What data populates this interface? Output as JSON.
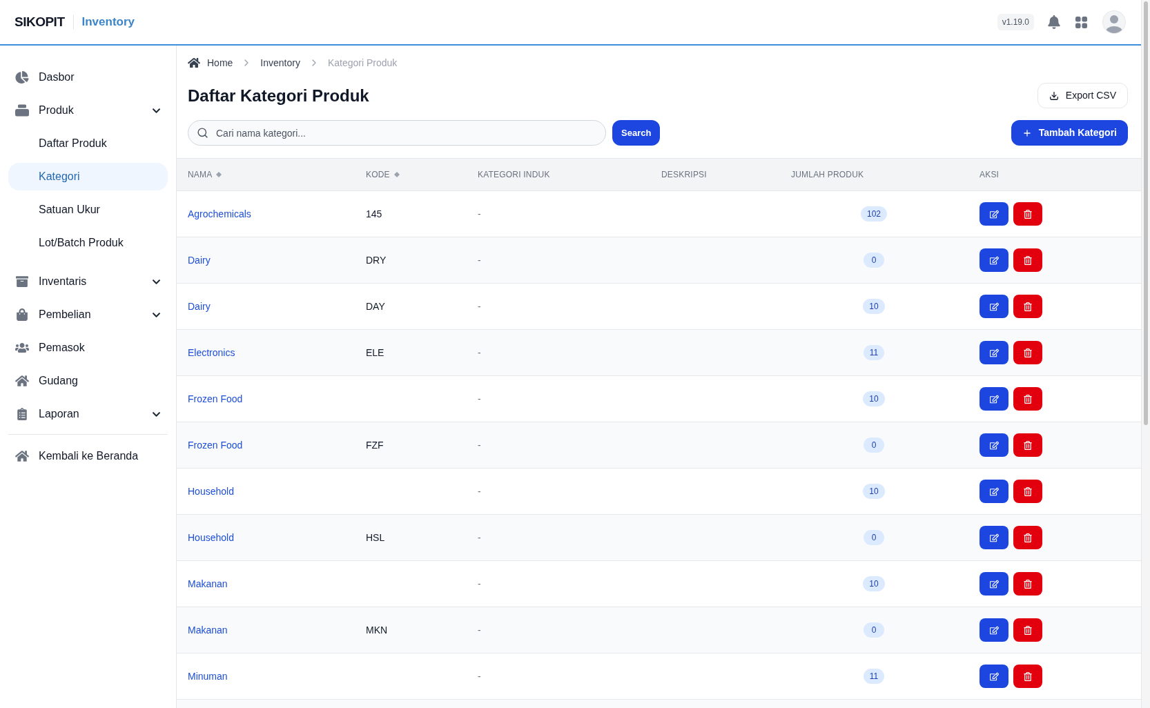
{
  "header": {
    "brand": "SIKOPIT",
    "module": "Inventory",
    "version": "v1.19.0"
  },
  "sidebar": {
    "items": [
      {
        "label": "Dasbor",
        "kind": "link",
        "selected": false
      },
      {
        "label": "Produk",
        "kind": "group",
        "selected": false,
        "children": [
          {
            "label": "Daftar Produk",
            "selected": false
          },
          {
            "label": "Kategori",
            "selected": true
          },
          {
            "label": "Satuan Ukur",
            "selected": false
          },
          {
            "label": "Lot/Batch Produk",
            "selected": false
          }
        ]
      },
      {
        "label": "Inventaris",
        "kind": "group",
        "selected": false
      },
      {
        "label": "Pembelian",
        "kind": "group",
        "selected": false
      },
      {
        "label": "Pemasok",
        "kind": "link",
        "selected": false
      },
      {
        "label": "Gudang",
        "kind": "link",
        "selected": false
      },
      {
        "label": "Laporan",
        "kind": "group",
        "selected": false
      }
    ],
    "footer_items": [
      {
        "label": "Kembali ke Beranda",
        "selected": false
      }
    ]
  },
  "breadcrumb": [
    {
      "label": "Home",
      "current": false
    },
    {
      "label": "Inventory",
      "current": false
    },
    {
      "label": "Kategori Produk",
      "current": true
    }
  ],
  "page_title": "Daftar Kategori Produk",
  "export_button": "Export CSV",
  "search": {
    "placeholder": "Cari nama kategori...",
    "button": "Search"
  },
  "add_button": "Tambah Kategori",
  "table": {
    "columns": [
      {
        "label": "NAMA",
        "sortable": true
      },
      {
        "label": "KODE",
        "sortable": true
      },
      {
        "label": "KATEGORI INDUK",
        "sortable": false
      },
      {
        "label": "DESKRIPSI",
        "sortable": false
      },
      {
        "label": "JUMLAH PRODUK",
        "sortable": false
      },
      {
        "label": "AKSI",
        "sortable": false
      }
    ],
    "rows": [
      {
        "nama": "Agrochemicals",
        "kode": "145",
        "kategori_induk": "-",
        "jumlah_produk": "102"
      },
      {
        "nama": "Dairy",
        "kode": "DRY",
        "kategori_induk": "-",
        "jumlah_produk": "0"
      },
      {
        "nama": "Dairy",
        "kode": "DAY",
        "kategori_induk": "-",
        "jumlah_produk": "10"
      },
      {
        "nama": "Electronics",
        "kode": "ELE",
        "kategori_induk": "-",
        "jumlah_produk": "11"
      },
      {
        "nama": "Frozen Food",
        "kategori_induk": "-",
        "jumlah_produk": "10"
      },
      {
        "nama": "Frozen Food",
        "kode": "FZF",
        "kategori_induk": "-",
        "jumlah_produk": "0"
      },
      {
        "nama": "Household",
        "kategori_induk": "-",
        "jumlah_produk": "10"
      },
      {
        "nama": "Household",
        "kode": "HSL",
        "kategori_induk": "-",
        "jumlah_produk": "0"
      },
      {
        "nama": "Makanan",
        "kategori_induk": "-",
        "jumlah_produk": "10"
      },
      {
        "nama": "Makanan",
        "kode": "MKN",
        "kategori_induk": "-",
        "jumlah_produk": "0"
      },
      {
        "nama": "Minuman",
        "kategori_induk": "-",
        "jumlah_produk": "11"
      }
    ]
  }
}
